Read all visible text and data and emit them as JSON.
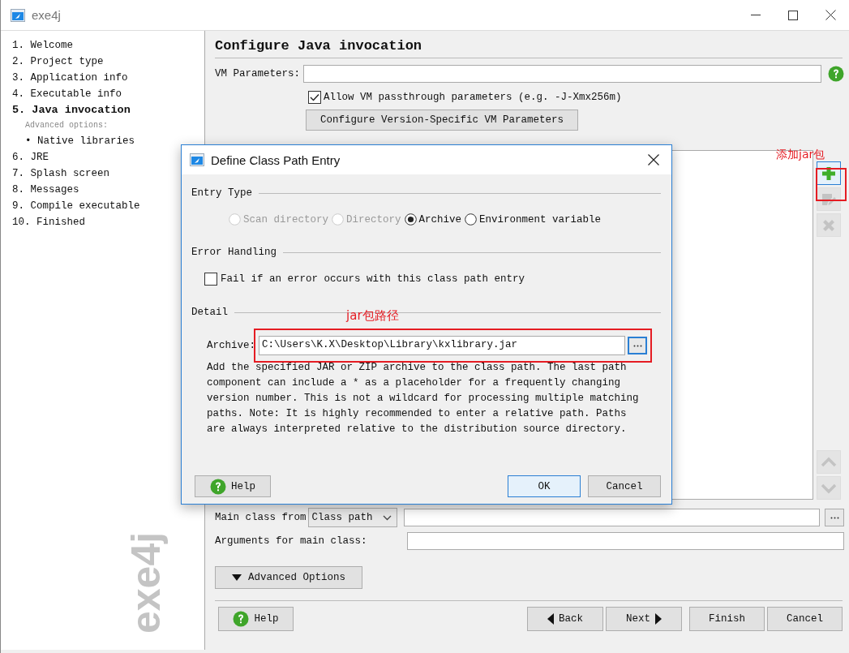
{
  "window": {
    "title": "exe4j"
  },
  "sidebar": {
    "items": [
      {
        "kind": "step",
        "label": "1. Welcome",
        "selected": false
      },
      {
        "kind": "step",
        "label": "2. Project type",
        "selected": false
      },
      {
        "kind": "step",
        "label": "3. Application info",
        "selected": false
      },
      {
        "kind": "step",
        "label": "4. Executable info",
        "selected": false
      },
      {
        "kind": "step",
        "label": "5. Java invocation",
        "selected": true
      },
      {
        "kind": "heading",
        "label": "Advanced options:"
      },
      {
        "kind": "sub",
        "label": "• Native libraries",
        "selected": false
      },
      {
        "kind": "step",
        "label": "6. JRE",
        "selected": false
      },
      {
        "kind": "step",
        "label": "7. Splash screen",
        "selected": false
      },
      {
        "kind": "step",
        "label": "8. Messages",
        "selected": false
      },
      {
        "kind": "step",
        "label": "9. Compile executable",
        "selected": false
      },
      {
        "kind": "step",
        "label": "10. Finished",
        "selected": false
      }
    ],
    "logo": "exe4j"
  },
  "page": {
    "title": "Configure Java invocation",
    "vm_parameters": {
      "label": "VM Parameters:"
    },
    "passthrough": {
      "label": "Allow VM passthrough parameters (e.g. -J-Xmx256m)",
      "checked": true
    },
    "version_button": "Configure Version-Specific VM Parameters",
    "list_tools": [
      {
        "kind": "add",
        "disabled": false
      },
      {
        "kind": "edit",
        "disabled": true
      },
      {
        "kind": "remove",
        "disabled": true
      },
      {
        "kind": "up",
        "disabled": true
      },
      {
        "kind": "down",
        "disabled": true
      }
    ],
    "main_class": {
      "label": "Main class from",
      "source": "Class path"
    },
    "arguments": {
      "label": "Arguments for main class:"
    },
    "advanced_button": "Advanced Options"
  },
  "buttons": [
    {
      "kind": "help",
      "label": "Help"
    },
    {
      "kind": "back",
      "label": "Back"
    },
    {
      "kind": "next",
      "label": "Next"
    },
    {
      "kind": "finish",
      "label": "Finish"
    },
    {
      "kind": "cancel",
      "label": "Cancel"
    }
  ],
  "dialog": {
    "title": "Define Class Path Entry",
    "entry_type": {
      "heading": "Entry Type",
      "options": [
        {
          "label": "Scan directory",
          "selected": false,
          "disabled": true
        },
        {
          "label": "Directory",
          "selected": false,
          "disabled": true
        },
        {
          "label": "Archive",
          "selected": true,
          "disabled": false
        },
        {
          "label": "Environment variable",
          "selected": false,
          "disabled": false
        }
      ]
    },
    "error_handling": {
      "heading": "Error Handling",
      "checkbox": {
        "label": "Fail if an error occurs with this class path entry",
        "checked": false
      }
    },
    "detail": {
      "heading": "Detail",
      "archive_label": "Archive:",
      "archive_value": "C:\\Users\\K.X\\Desktop\\Library\\kxlibrary.jar",
      "description": "Add the specified JAR or ZIP archive to the class path. The last path component can include a * as a placeholder for a frequently changing version number. This is not a wildcard for processing multiple matching paths. Note: It is highly recommended to enter a relative path. Paths are always interpreted relative to the distribution source directory."
    },
    "buttons": [
      {
        "kind": "help",
        "label": "Help",
        "default": false
      },
      {
        "kind": "ok",
        "label": "OK",
        "default": true
      },
      {
        "kind": "cancel",
        "label": "Cancel",
        "default": false
      }
    ]
  },
  "annotations": [
    {
      "kind": "add",
      "label": "添加jar包"
    },
    {
      "kind": "path",
      "label": "jar包路径"
    }
  ]
}
